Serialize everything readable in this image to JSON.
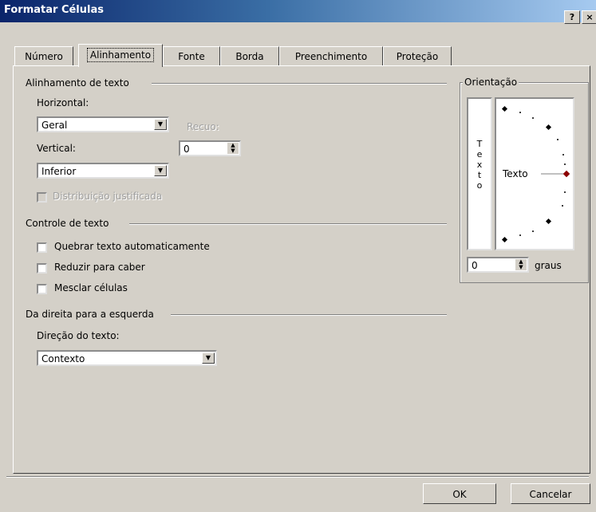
{
  "window": {
    "title": "Formatar Células",
    "help_label": "?",
    "close_label": "×"
  },
  "tabs": [
    {
      "label": "Número"
    },
    {
      "label": "Alinhamento"
    },
    {
      "label": "Fonte"
    },
    {
      "label": "Borda"
    },
    {
      "label": "Preenchimento"
    },
    {
      "label": "Proteção"
    }
  ],
  "alignment": {
    "section_title": "Alinhamento de texto",
    "horizontal_label": "Horizontal:",
    "horizontal_value": "Geral",
    "indent_label": "Recuo:",
    "indent_value": "0",
    "vertical_label": "Vertical:",
    "vertical_value": "Inferior",
    "justify_distributed_label": "Distribuição justificada"
  },
  "text_control": {
    "section_title": "Controle de texto",
    "wrap_label": "Quebrar texto automaticamente",
    "shrink_label": "Reduzir para caber",
    "merge_label": "Mesclar células"
  },
  "rtl": {
    "section_title": "Da direita para a esquerda",
    "direction_label": "Direção do texto:",
    "direction_value": "Contexto"
  },
  "orientation": {
    "section_title": "Orientação",
    "vertical_text": [
      "T",
      "e",
      "x",
      "t",
      "o"
    ],
    "dial_label": "Texto",
    "degrees_value": "0",
    "degrees_label": "graus"
  },
  "footer": {
    "ok_label": "OK",
    "cancel_label": "Cancelar"
  },
  "colors": {
    "title_start": "#0a246a",
    "title_end": "#a6caf0",
    "dialog_bg": "#d4d0c8",
    "dial_marker": "#8b0000"
  }
}
